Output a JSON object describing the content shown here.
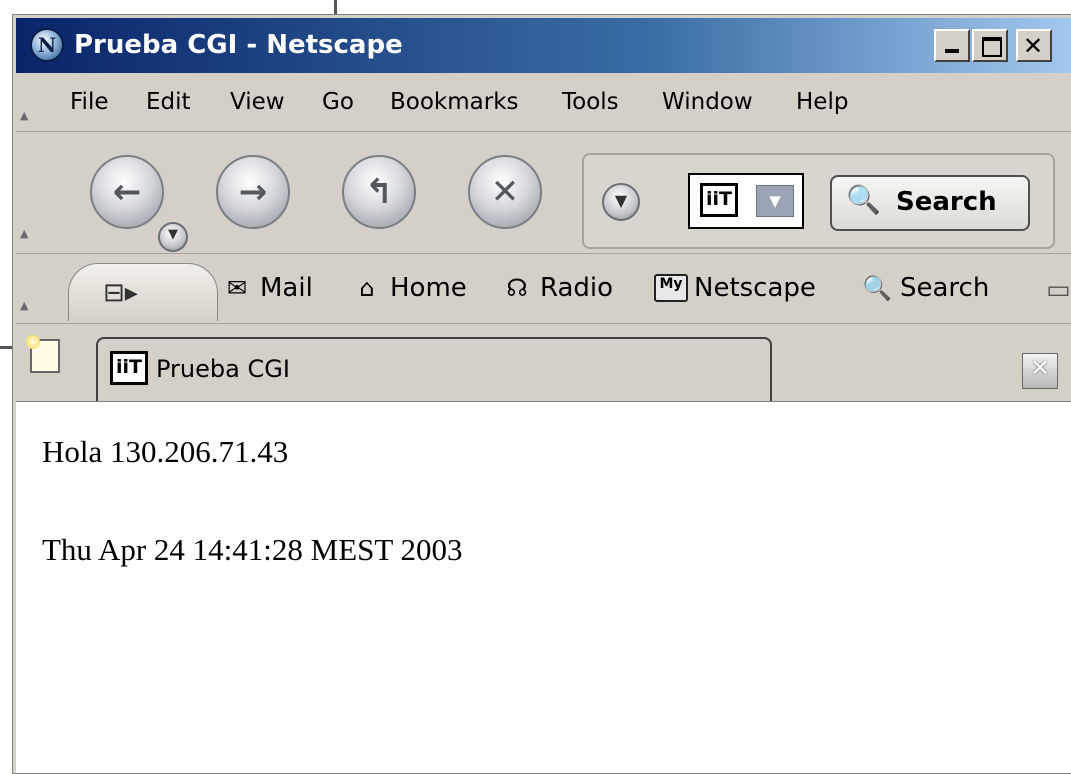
{
  "window": {
    "title": "Prueba CGI - Netscape",
    "app_icon_letter": "N"
  },
  "title_buttons": {
    "minimize": "_",
    "maximize": "□",
    "close": "✕"
  },
  "menubar": {
    "items": [
      {
        "label": "File"
      },
      {
        "label": "Edit"
      },
      {
        "label": "View"
      },
      {
        "label": "Go"
      },
      {
        "label": "Bookmarks"
      },
      {
        "label": "Tools"
      },
      {
        "label": "Window"
      },
      {
        "label": "Help"
      }
    ]
  },
  "navbar": {
    "back_icon": "back-arrow-icon",
    "forward_icon": "forward-arrow-icon",
    "reload_icon": "reload-icon",
    "stop_icon": "stop-icon",
    "search_engine_logo": "iiT",
    "search_label": "Search"
  },
  "personal_toolbar": {
    "items": [
      {
        "label": "Mail",
        "icon": "mail-icon"
      },
      {
        "label": "Home",
        "icon": "home-icon"
      },
      {
        "label": "Radio",
        "icon": "headphones-icon"
      },
      {
        "label": "Netscape",
        "icon": "my-netscape-icon",
        "icon_text": "My"
      },
      {
        "label": "Search",
        "icon": "search-icon"
      }
    ]
  },
  "tabs": [
    {
      "label": "Prueba CGI",
      "favicon": "iiT",
      "active": true
    }
  ],
  "content": {
    "lines": [
      "Hola 130.206.71.43",
      "Thu Apr 24 14:41:28 MEST 2003"
    ]
  },
  "colors": {
    "titlebar_start": "#0a246a",
    "titlebar_end": "#a6caf0",
    "chrome": "#d4d0c8",
    "content_bg": "#ffffff"
  }
}
